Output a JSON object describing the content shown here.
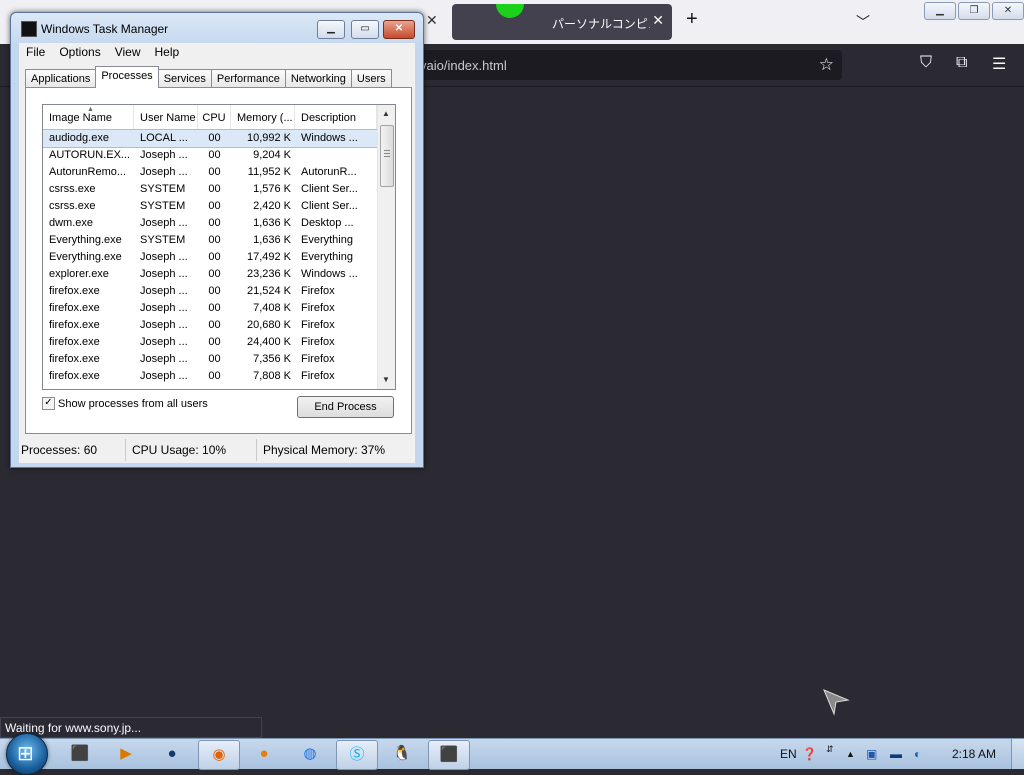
{
  "browser": {
    "tab_title": "パーソナルコンピューター VAIO",
    "url_visible": "vaio/index.html",
    "status_text": "Waiting for www.sony.jp...",
    "icons": [
      "close-tab-icon",
      "new-tab-icon",
      "list-all-tabs-icon",
      "bookmark-star-icon",
      "pocket-icon",
      "extensions-icon",
      "menu-icon"
    ]
  },
  "task_manager": {
    "title": "Windows Task Manager",
    "menu": [
      "File",
      "Options",
      "View",
      "Help"
    ],
    "tabs": [
      "Applications",
      "Processes",
      "Services",
      "Performance",
      "Networking",
      "Users"
    ],
    "active_tab": "Processes",
    "columns": [
      "Image Name",
      "User Name",
      "CPU",
      "Memory (...",
      "Description"
    ],
    "rows": [
      {
        "name": "audiodg.exe",
        "user": "LOCAL ...",
        "cpu": "00",
        "mem": "10,992 K",
        "desc": "Windows ..."
      },
      {
        "name": "AUTORUN.EX...",
        "user": "Joseph ...",
        "cpu": "00",
        "mem": "9,204 K",
        "desc": ""
      },
      {
        "name": "AutorunRemo...",
        "user": "Joseph ...",
        "cpu": "00",
        "mem": "11,952 K",
        "desc": "AutorunR..."
      },
      {
        "name": "csrss.exe",
        "user": "SYSTEM",
        "cpu": "00",
        "mem": "1,576 K",
        "desc": "Client Ser..."
      },
      {
        "name": "csrss.exe",
        "user": "SYSTEM",
        "cpu": "00",
        "mem": "2,420 K",
        "desc": "Client Ser..."
      },
      {
        "name": "dwm.exe",
        "user": "Joseph ...",
        "cpu": "00",
        "mem": "1,636 K",
        "desc": "Desktop ..."
      },
      {
        "name": "Everything.exe",
        "user": "SYSTEM",
        "cpu": "00",
        "mem": "1,636 K",
        "desc": "Everything"
      },
      {
        "name": "Everything.exe",
        "user": "Joseph ...",
        "cpu": "00",
        "mem": "17,492 K",
        "desc": "Everything"
      },
      {
        "name": "explorer.exe",
        "user": "Joseph ...",
        "cpu": "00",
        "mem": "23,236 K",
        "desc": "Windows ..."
      },
      {
        "name": "firefox.exe",
        "user": "Joseph ...",
        "cpu": "00",
        "mem": "21,524 K",
        "desc": "Firefox"
      },
      {
        "name": "firefox.exe",
        "user": "Joseph ...",
        "cpu": "00",
        "mem": "7,408 K",
        "desc": "Firefox"
      },
      {
        "name": "firefox.exe",
        "user": "Joseph ...",
        "cpu": "00",
        "mem": "20,680 K",
        "desc": "Firefox"
      },
      {
        "name": "firefox.exe",
        "user": "Joseph ...",
        "cpu": "00",
        "mem": "24,400 K",
        "desc": "Firefox"
      },
      {
        "name": "firefox.exe",
        "user": "Joseph ...",
        "cpu": "00",
        "mem": "7,356 K",
        "desc": "Firefox"
      },
      {
        "name": "firefox.exe",
        "user": "Joseph ...",
        "cpu": "00",
        "mem": "7,808 K",
        "desc": "Firefox"
      }
    ],
    "selected_row": 0,
    "show_all_label": "Show processes from all users",
    "show_all_checked": true,
    "end_process_label": "End Process",
    "status": {
      "processes": "Processes: 60",
      "cpu": "CPU Usage: 10%",
      "memory": "Physical Memory: 37%"
    }
  },
  "taskbar": {
    "pinned": [
      "media-icon",
      "vlc-icon",
      "globe-icon",
      "firefox-icon",
      "blender-icon",
      "chrome-icon",
      "skype-icon",
      "tux-icon",
      "terminal-icon"
    ],
    "language": "EN",
    "clock": "2:18 AM"
  },
  "colors": {
    "browser_bg": "#2b2a33",
    "taskbar": "#b8cde6",
    "selection": "#dbe8f7"
  }
}
